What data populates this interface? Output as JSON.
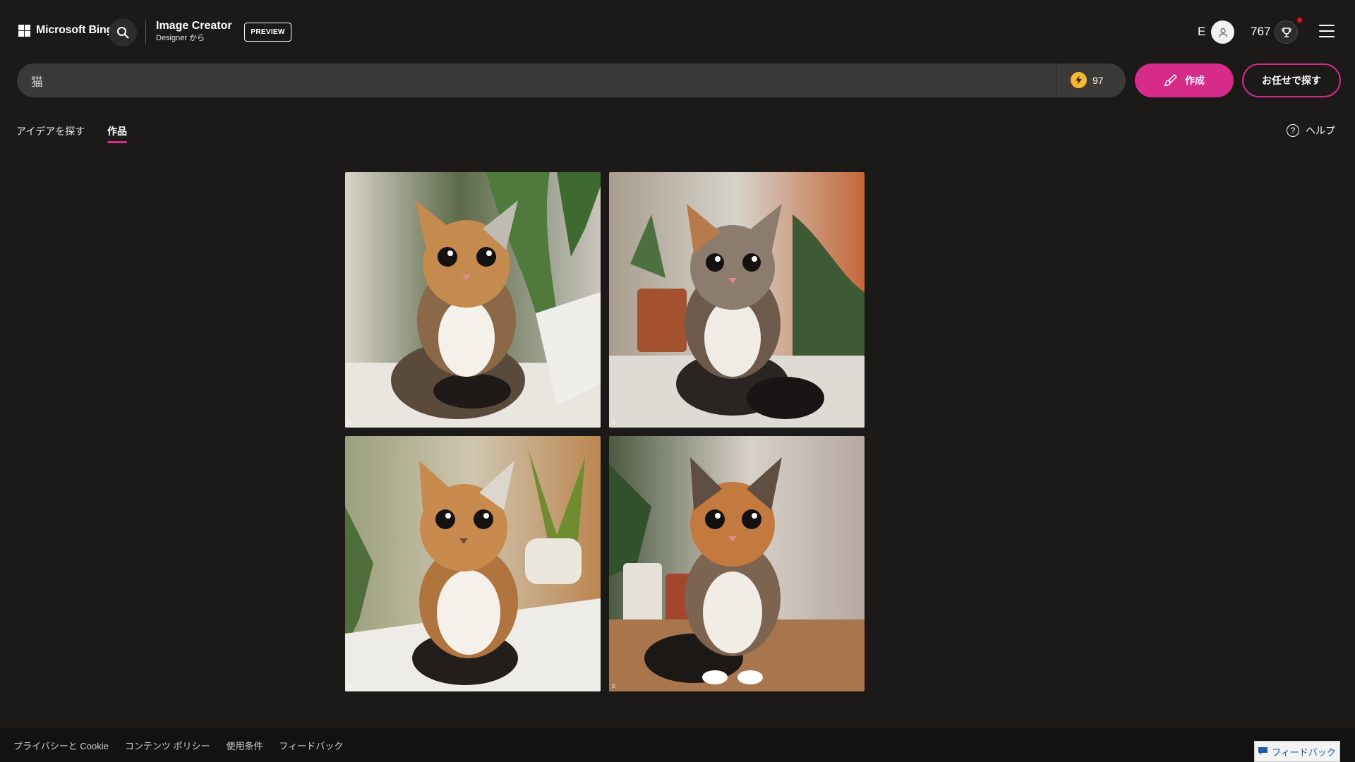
{
  "header": {
    "brand": "Microsoft Bing",
    "app_title": "Image Creator",
    "app_subtitle": "Designer から",
    "badge": "PREVIEW",
    "user_initial": "E",
    "reward_points": "767"
  },
  "prompt": {
    "value": "猫",
    "boosts": "97",
    "create_label": "作成",
    "surprise_label": "お任せで探す"
  },
  "tabs": {
    "explore": "アイデアを探す",
    "creations": "作品",
    "active": "creations"
  },
  "help_label": "ヘルプ",
  "images": [
    {
      "subject": "calico-cat-window-plants-1"
    },
    {
      "subject": "calico-cat-window-plants-2"
    },
    {
      "subject": "calico-cat-window-plants-3"
    },
    {
      "subject": "calico-cat-window-plants-4"
    }
  ],
  "footer": {
    "links": [
      "プライバシーと Cookie",
      "コンテンツ ポリシー",
      "使用条件",
      "フィードバック"
    ],
    "feedback_button": "フィードバック"
  },
  "colors": {
    "accent": "#d72b89",
    "background": "#1b1a19",
    "coin": "#f5b82e"
  }
}
